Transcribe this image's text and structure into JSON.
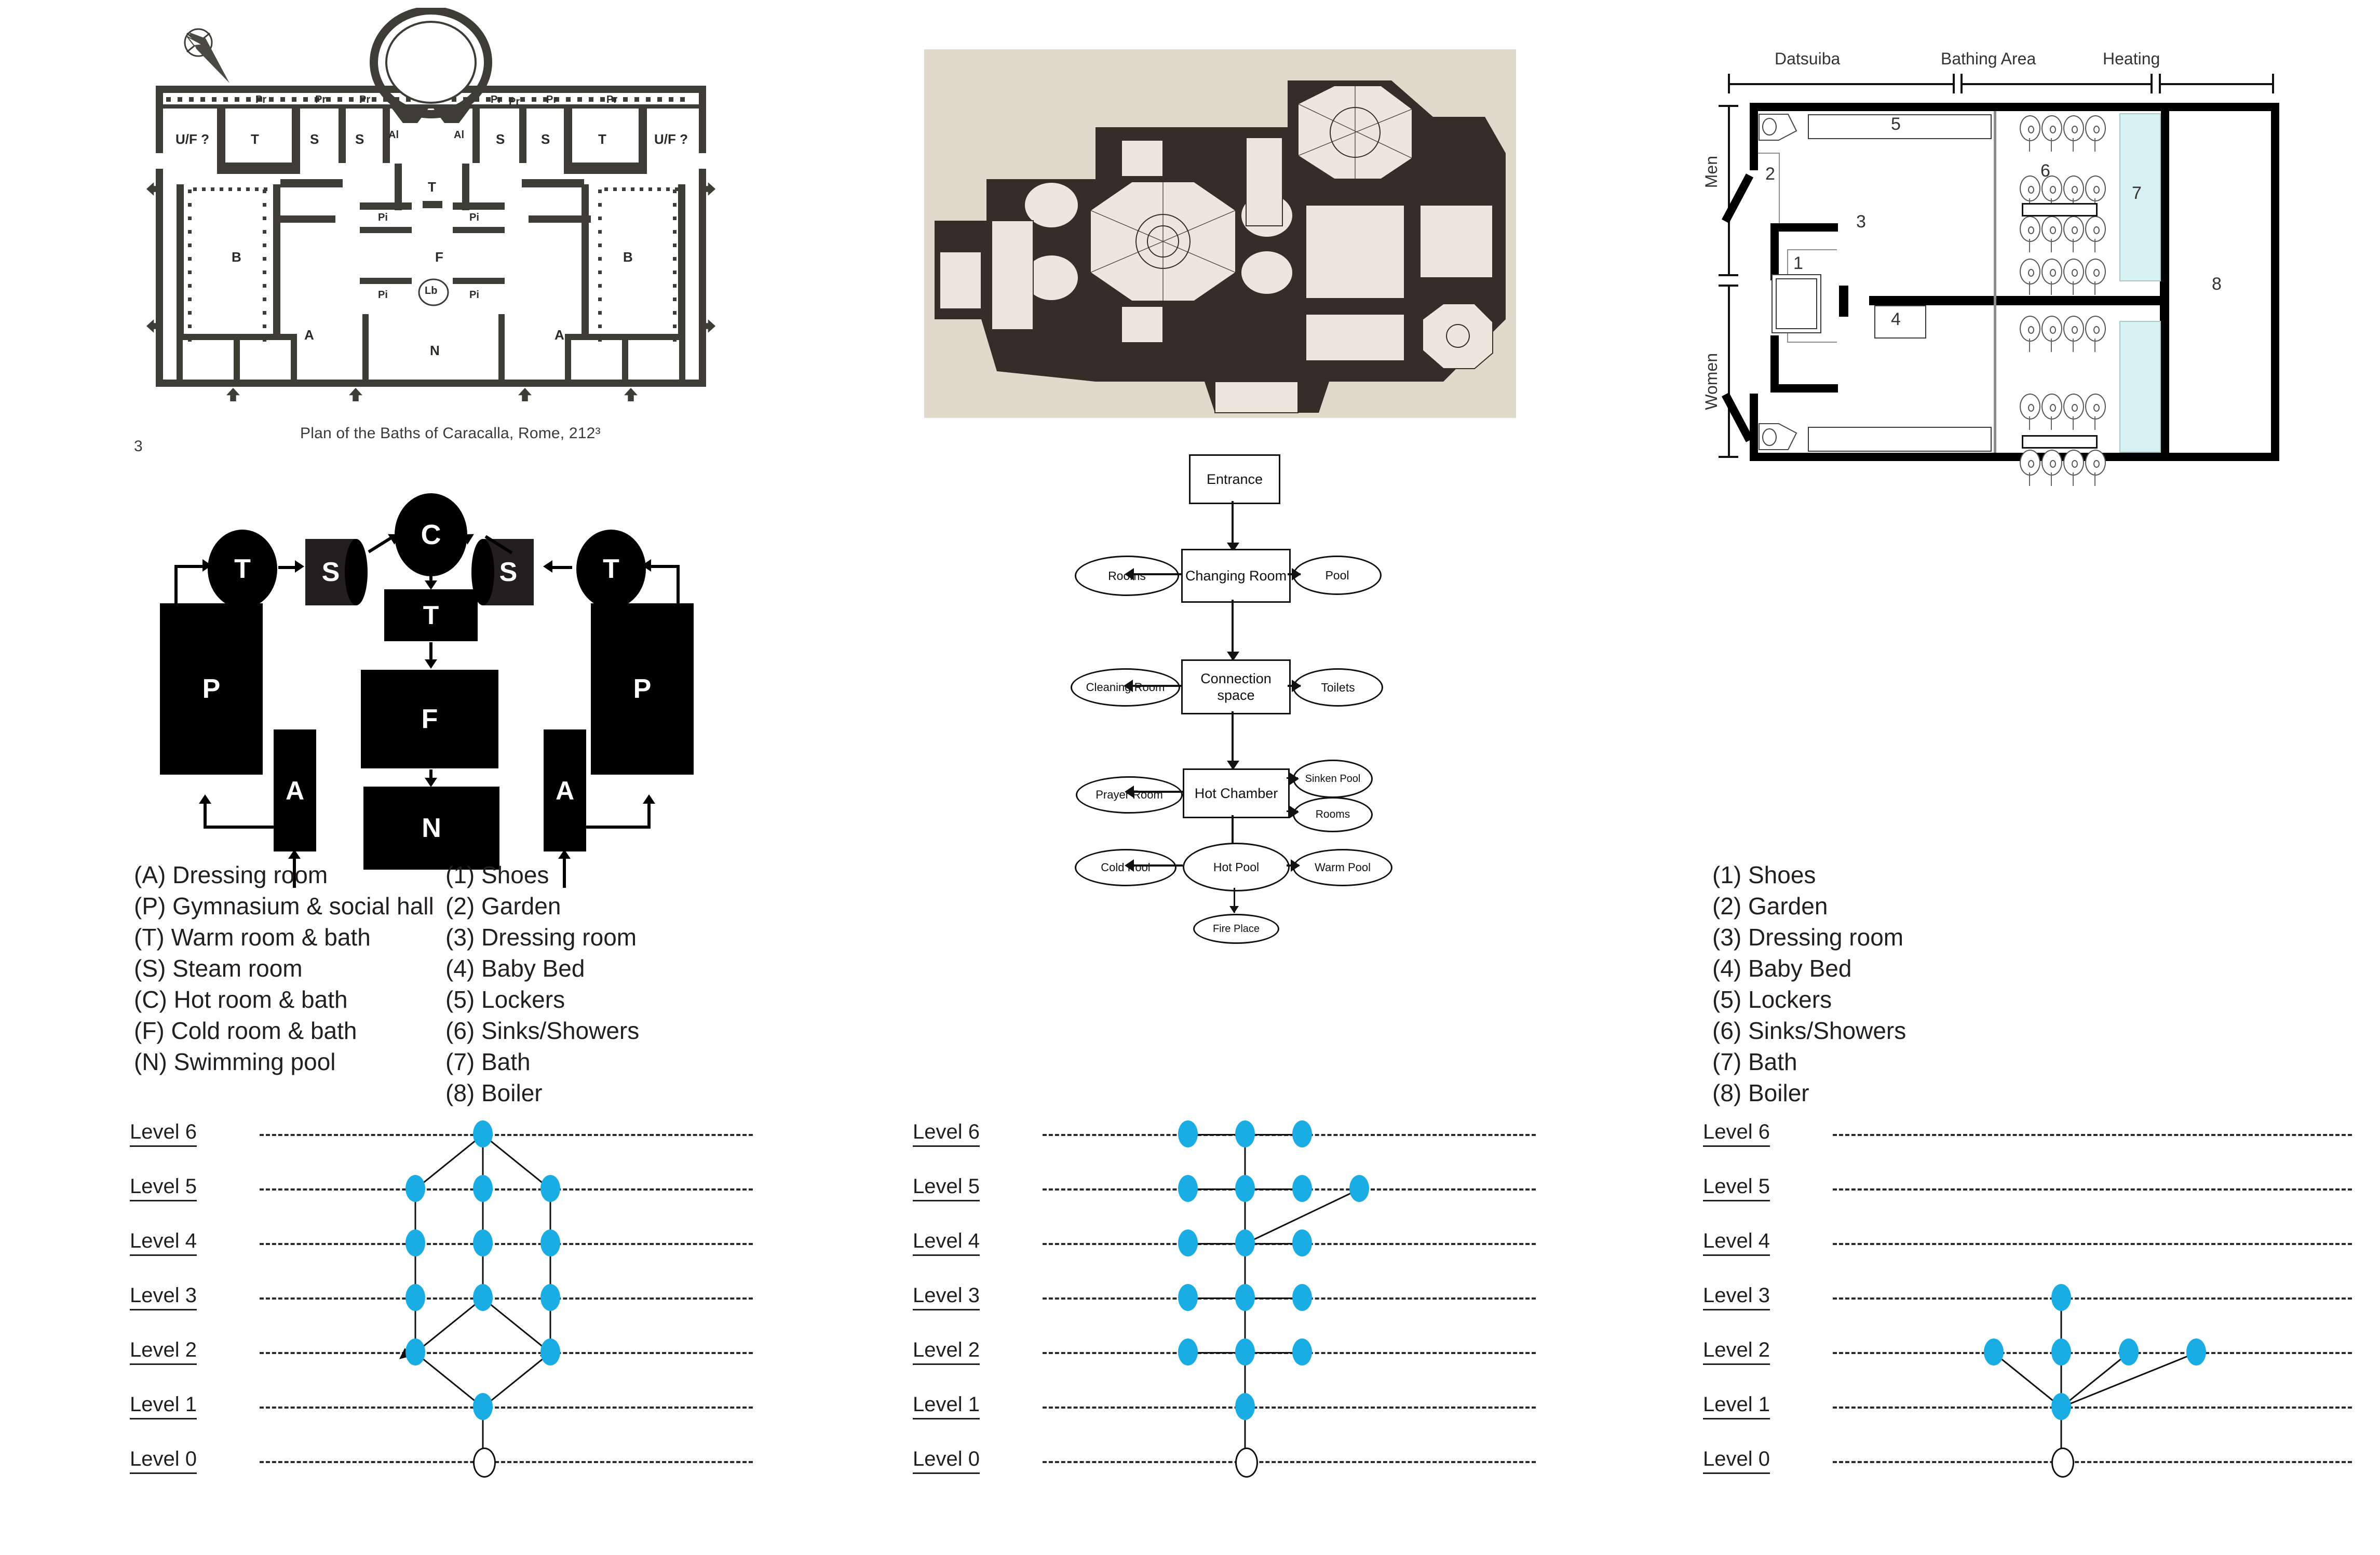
{
  "page": {
    "number": "3"
  },
  "roman_plan": {
    "caption": "Plan of the Baths of Caracalla, Rome, 212³",
    "room_labels": [
      "U/F ?",
      "T",
      "S",
      "S",
      "Al",
      "Al",
      "S",
      "S",
      "T",
      "U/F ?",
      "Pr",
      "Pr",
      "Pr",
      "Pr",
      "Pr",
      "Pr",
      "Pr",
      "Pr",
      "T",
      "Pi",
      "Pi",
      "B",
      "F",
      "B",
      "Pi",
      "Lb",
      "Pi",
      "A",
      "A",
      "N"
    ],
    "compass_icon": "north-arrow-icon"
  },
  "ottoman_plan": {
    "alt": "Ottoman hammam plan (scanned figure)"
  },
  "sento_plan": {
    "headers": [
      "Datsuiba",
      "Bathing Area",
      "Heating"
    ],
    "side_labels": [
      "Men",
      "Women"
    ],
    "numbers": [
      "5",
      "2",
      "3",
      "1",
      "4",
      "6",
      "7",
      "8"
    ]
  },
  "access_graph": {
    "nodes": [
      {
        "id": "T-left",
        "label": "T"
      },
      {
        "id": "S-left",
        "label": "S"
      },
      {
        "id": "C",
        "label": "C"
      },
      {
        "id": "S-right",
        "label": "S"
      },
      {
        "id": "T-right",
        "label": "T"
      },
      {
        "id": "T-mid",
        "label": "T"
      },
      {
        "id": "P-left",
        "label": "P"
      },
      {
        "id": "F",
        "label": "F"
      },
      {
        "id": "P-right",
        "label": "P"
      },
      {
        "id": "A-left",
        "label": "A"
      },
      {
        "id": "N",
        "label": "N"
      },
      {
        "id": "A-right",
        "label": "A"
      }
    ]
  },
  "legend_letters": [
    "(A) Dressing room",
    "(P) Gymnasium & social hall",
    "(T) Warm room & bath",
    "(S) Steam room",
    "(C) Hot room & bath",
    "(F) Cold room & bath",
    "(N) Swimming pool"
  ],
  "legend_numbers": [
    "(1) Shoes",
    "(2) Garden",
    "(3) Dressing room",
    "(4) Baby Bed",
    "(5) Lockers",
    "(6) Sinks/Showers",
    "(7) Bath",
    "(8) Boiler"
  ],
  "legend_numbers_right": [
    "(1) Shoes",
    "(2) Garden",
    "(3) Dressing room",
    "(4) Baby Bed",
    "(5) Lockers",
    "(6) Sinks/Showers",
    "(7) Bath",
    "(8) Boiler"
  ],
  "flowchart": {
    "nodes": [
      {
        "id": "entrance",
        "label": "Entrance",
        "shape": "rect"
      },
      {
        "id": "changing",
        "label": "Changing Room",
        "shape": "rect"
      },
      {
        "id": "rooms1",
        "label": "Rooms",
        "shape": "ellipse"
      },
      {
        "id": "pool",
        "label": "Pool",
        "shape": "ellipse"
      },
      {
        "id": "connection",
        "label": "Connection space",
        "shape": "rect"
      },
      {
        "id": "cleaning",
        "label": "Cleaning Room",
        "shape": "ellipse"
      },
      {
        "id": "toilets",
        "label": "Toilets",
        "shape": "ellipse"
      },
      {
        "id": "hotchamber",
        "label": "Hot Chamber",
        "shape": "rect"
      },
      {
        "id": "prayer",
        "label": "Prayer Room",
        "shape": "ellipse"
      },
      {
        "id": "sinken",
        "label": "Sinken Pool",
        "shape": "ellipse"
      },
      {
        "id": "rooms2",
        "label": "Rooms",
        "shape": "ellipse"
      },
      {
        "id": "hotpool",
        "label": "Hot Pool",
        "shape": "ellipse"
      },
      {
        "id": "coldpool",
        "label": "Cold Pool",
        "shape": "ellipse"
      },
      {
        "id": "warmpool",
        "label": "Warm Pool",
        "shape": "ellipse"
      },
      {
        "id": "fireplace",
        "label": "Fire Place",
        "shape": "ellipse"
      }
    ]
  },
  "chart_data": [
    {
      "type": "graph",
      "name": "justified-graph-roman",
      "title": "",
      "levels": [
        "Level 6",
        "Level 5",
        "Level 4",
        "Level 3",
        "Level 2",
        "Level 1",
        "Level 0"
      ],
      "node_color": "#19ade4",
      "root_color": "#ffffff",
      "nodes": [
        {
          "id": "r0",
          "level": 0,
          "x": 0,
          "root": true
        },
        {
          "id": "r1",
          "level": 1,
          "x": 0
        },
        {
          "id": "r2a",
          "level": 2,
          "x": -1
        },
        {
          "id": "r2b",
          "level": 2,
          "x": 1
        },
        {
          "id": "r3a",
          "level": 3,
          "x": -1
        },
        {
          "id": "r3b",
          "level": 3,
          "x": 0
        },
        {
          "id": "r3c",
          "level": 3,
          "x": 1
        },
        {
          "id": "r4a",
          "level": 4,
          "x": -1
        },
        {
          "id": "r4b",
          "level": 4,
          "x": 0
        },
        {
          "id": "r4c",
          "level": 4,
          "x": 1
        },
        {
          "id": "r5a",
          "level": 5,
          "x": -1
        },
        {
          "id": "r5b",
          "level": 5,
          "x": 0
        },
        {
          "id": "r5c",
          "level": 5,
          "x": 1
        },
        {
          "id": "r6",
          "level": 6,
          "x": 0
        }
      ],
      "edges": [
        [
          "r0",
          "r1"
        ],
        [
          "r1",
          "r2a"
        ],
        [
          "r1",
          "r2b"
        ],
        [
          "r2a",
          "r3a"
        ],
        [
          "r2b",
          "r3c"
        ],
        [
          "r3b",
          "r2a"
        ],
        [
          "r3b",
          "r2b"
        ],
        [
          "r3a",
          "r4a"
        ],
        [
          "r3b",
          "r4b"
        ],
        [
          "r3c",
          "r4c"
        ],
        [
          "r4a",
          "r5a"
        ],
        [
          "r4b",
          "r5b"
        ],
        [
          "r4c",
          "r5c"
        ],
        [
          "r5a",
          "r6"
        ],
        [
          "r5b",
          "r6"
        ],
        [
          "r5c",
          "r6"
        ]
      ],
      "arrow_edges": [
        [
          "r3b",
          "r2a"
        ],
        [
          "r3b",
          "r2b"
        ]
      ]
    },
    {
      "type": "graph",
      "name": "justified-graph-ottoman",
      "title": "",
      "levels": [
        "Level 6",
        "Level 5",
        "Level 4",
        "Level 3",
        "Level 2",
        "Level 1",
        "Level 0"
      ],
      "node_color": "#19ade4",
      "root_color": "#ffffff",
      "nodes": [
        {
          "id": "o0",
          "level": 0,
          "x": 0,
          "root": true
        },
        {
          "id": "o1",
          "level": 1,
          "x": 0
        },
        {
          "id": "o2a",
          "level": 2,
          "x": -1
        },
        {
          "id": "o2b",
          "level": 2,
          "x": 0
        },
        {
          "id": "o2c",
          "level": 2,
          "x": 1
        },
        {
          "id": "o3a",
          "level": 3,
          "x": -1
        },
        {
          "id": "o3b",
          "level": 3,
          "x": 0
        },
        {
          "id": "o3c",
          "level": 3,
          "x": 1
        },
        {
          "id": "o4a",
          "level": 4,
          "x": -1
        },
        {
          "id": "o4b",
          "level": 4,
          "x": 0
        },
        {
          "id": "o4c",
          "level": 4,
          "x": 1
        },
        {
          "id": "o5a",
          "level": 5,
          "x": -1
        },
        {
          "id": "o5b",
          "level": 5,
          "x": 0
        },
        {
          "id": "o5c",
          "level": 5,
          "x": 1
        },
        {
          "id": "o5d",
          "level": 5,
          "x": 2
        },
        {
          "id": "o6a",
          "level": 6,
          "x": -1
        },
        {
          "id": "o6b",
          "level": 6,
          "x": 0
        },
        {
          "id": "o6c",
          "level": 6,
          "x": 1
        }
      ],
      "edges": [
        [
          "o0",
          "o1"
        ],
        [
          "o1",
          "o2b"
        ],
        [
          "o2b",
          "o2a"
        ],
        [
          "o2b",
          "o2c"
        ],
        [
          "o2b",
          "o3b"
        ],
        [
          "o3b",
          "o3a"
        ],
        [
          "o3b",
          "o3c"
        ],
        [
          "o3b",
          "o4b"
        ],
        [
          "o4b",
          "o4a"
        ],
        [
          "o4b",
          "o4c"
        ],
        [
          "o4b",
          "o5b"
        ],
        [
          "o4b",
          "o5d"
        ],
        [
          "o5b",
          "o5a"
        ],
        [
          "o5b",
          "o5c"
        ],
        [
          "o5b",
          "o6b"
        ],
        [
          "o6b",
          "o6a"
        ],
        [
          "o6b",
          "o6c"
        ]
      ],
      "arrow_edges": []
    },
    {
      "type": "graph",
      "name": "justified-graph-sento",
      "title": "",
      "levels": [
        "Level 6",
        "Level 5",
        "Level 4",
        "Level 3",
        "Level 2",
        "Level 1",
        "Level 0"
      ],
      "node_color": "#19ade4",
      "root_color": "#ffffff",
      "nodes": [
        {
          "id": "s0",
          "level": 0,
          "x": 0,
          "root": true
        },
        {
          "id": "s1",
          "level": 1,
          "x": 0
        },
        {
          "id": "s2a",
          "level": 2,
          "x": -1
        },
        {
          "id": "s2b",
          "level": 2,
          "x": 0
        },
        {
          "id": "s2c",
          "level": 2,
          "x": 1
        },
        {
          "id": "s2d",
          "level": 2,
          "x": 2
        },
        {
          "id": "s3",
          "level": 3,
          "x": 0
        }
      ],
      "edges": [
        [
          "s0",
          "s1"
        ],
        [
          "s1",
          "s2a"
        ],
        [
          "s1",
          "s2b"
        ],
        [
          "s1",
          "s2c"
        ],
        [
          "s1",
          "s2d"
        ],
        [
          "s1",
          "s3"
        ]
      ],
      "arrow_edges": []
    }
  ]
}
